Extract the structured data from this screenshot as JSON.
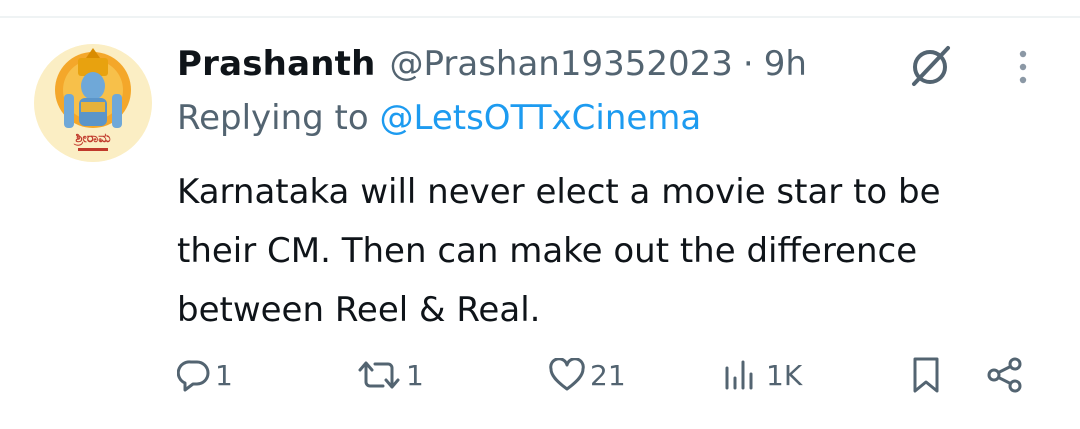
{
  "tweet": {
    "display_name": "Prashanth",
    "handle": "@Prashan19352023",
    "separator": "·",
    "time": "9h",
    "reply_prefix": "Replying to",
    "reply_target": "@LetsOTTxCinema",
    "text_lines": [
      "Karnataka will never elect a movie star to be",
      "their CM. Then can make out the difference",
      "between Reel & Real."
    ]
  },
  "actions": {
    "replies": "1",
    "reposts": "1",
    "likes": "21",
    "views": "1K"
  },
  "icons": {
    "grok": "grok-icon",
    "more": "more-vertical-icon",
    "reply": "reply-icon",
    "repost": "repost-icon",
    "like": "heart-icon",
    "views": "views-bar-chart-icon",
    "bookmark": "bookmark-icon",
    "share": "share-icon"
  },
  "colors": {
    "text": "#0f1419",
    "secondary": "#536471",
    "link": "#1d9bf0",
    "divider": "#eff3f4"
  }
}
